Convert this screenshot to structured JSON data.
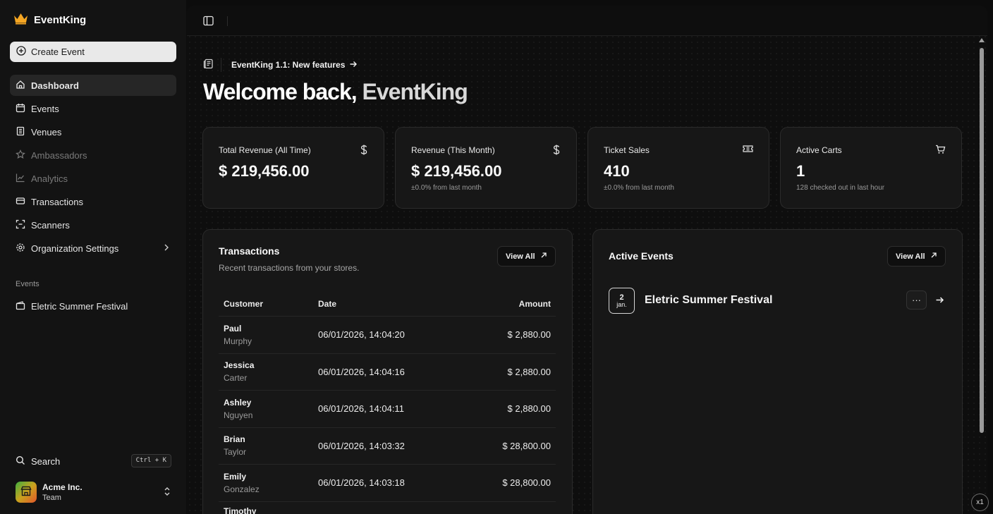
{
  "app": {
    "name": "EventKing"
  },
  "sidebar": {
    "create_label": "Create Event",
    "items": [
      {
        "label": "Dashboard",
        "icon": "home-icon",
        "active": true
      },
      {
        "label": "Events",
        "icon": "calendar-icon"
      },
      {
        "label": "Venues",
        "icon": "building-icon"
      },
      {
        "label": "Ambassadors",
        "icon": "star-icon",
        "disabled": true
      },
      {
        "label": "Analytics",
        "icon": "chart-line-icon",
        "disabled": true
      },
      {
        "label": "Transactions",
        "icon": "card-icon"
      },
      {
        "label": "Scanners",
        "icon": "scan-icon"
      },
      {
        "label": "Organization Settings",
        "icon": "gear-icon"
      }
    ],
    "events_section_label": "Events",
    "events": [
      {
        "label": "Eletric Summer Festival",
        "icon": "ticket-icon"
      }
    ],
    "search_label": "Search",
    "search_shortcut": "Ctrl + K",
    "team": {
      "name": "Acme Inc.",
      "plan": "Team"
    }
  },
  "announcement": {
    "text": "EventKing 1.1: New features"
  },
  "welcome": {
    "prefix": "Welcome back, ",
    "name": "EventKing"
  },
  "stats": [
    {
      "label": "Total Revenue (All Time)",
      "value": "$ 219,456.00",
      "sub": "",
      "icon": "dollar-icon"
    },
    {
      "label": "Revenue (This Month)",
      "value": "$ 219,456.00",
      "sub": "±0.0% from last month",
      "icon": "dollar-icon"
    },
    {
      "label": "Ticket Sales",
      "value": "410",
      "sub": "±0.0% from last month",
      "icon": "ticket-icon"
    },
    {
      "label": "Active Carts",
      "value": "1",
      "sub": "128 checked out in last hour",
      "icon": "cart-icon"
    }
  ],
  "transactions": {
    "title": "Transactions",
    "description": "Recent transactions from your stores.",
    "view_all": "View All",
    "columns": [
      "Customer",
      "Date",
      "Amount"
    ],
    "rows": [
      {
        "first": "Paul",
        "last": "Murphy",
        "date": "06/01/2026, 14:04:20",
        "amount": "$ 2,880.00"
      },
      {
        "first": "Jessica",
        "last": "Carter",
        "date": "06/01/2026, 14:04:16",
        "amount": "$ 2,880.00"
      },
      {
        "first": "Ashley",
        "last": "Nguyen",
        "date": "06/01/2026, 14:04:11",
        "amount": "$ 2,880.00"
      },
      {
        "first": "Brian",
        "last": "Taylor",
        "date": "06/01/2026, 14:03:32",
        "amount": "$ 28,800.00"
      },
      {
        "first": "Emily",
        "last": "Gonzalez",
        "date": "06/01/2026, 14:03:18",
        "amount": "$ 28,800.00"
      },
      {
        "first": "Timothy",
        "last": "",
        "date": "",
        "amount": ""
      }
    ]
  },
  "active_events": {
    "title": "Active Events",
    "view_all": "View All",
    "items": [
      {
        "day": "2",
        "month": "jan.",
        "name": "Eletric Summer Festival",
        "more": "···"
      }
    ]
  },
  "zoom": {
    "label": "x1"
  }
}
